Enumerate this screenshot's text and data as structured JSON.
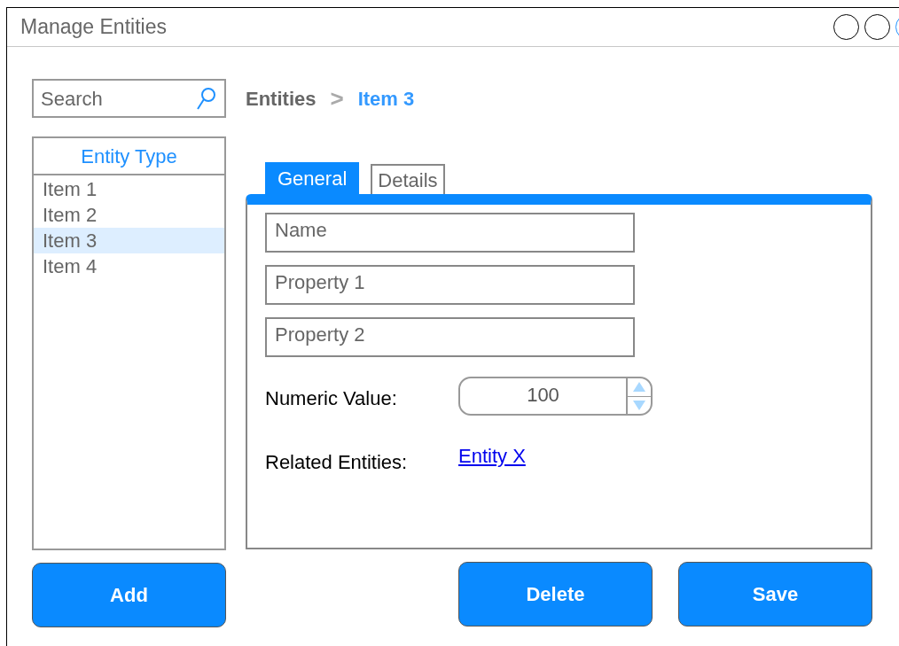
{
  "window": {
    "title": "Manage Entities"
  },
  "search": {
    "placeholder": "Search"
  },
  "breadcrumb": {
    "items": [
      "Entities",
      "Item 3"
    ],
    "separator": ">"
  },
  "entity_list": {
    "header": "Entity Type",
    "items": [
      {
        "label": "Item 1",
        "selected": false
      },
      {
        "label": "Item 2",
        "selected": false
      },
      {
        "label": "Item 3",
        "selected": true
      },
      {
        "label": "Item 4",
        "selected": false
      }
    ]
  },
  "tabs": [
    {
      "label": "General",
      "selected": true
    },
    {
      "label": "Details",
      "selected": false
    }
  ],
  "fields": [
    {
      "placeholder": "Name"
    },
    {
      "placeholder": "Property 1"
    },
    {
      "placeholder": "Property 2"
    }
  ],
  "numeric": {
    "label": "Numeric Value:",
    "value": "100"
  },
  "related": {
    "label": "Related Entities:",
    "link": "Entity X"
  },
  "buttons": {
    "add": "Add",
    "delete": "Delete",
    "save": "Save"
  }
}
